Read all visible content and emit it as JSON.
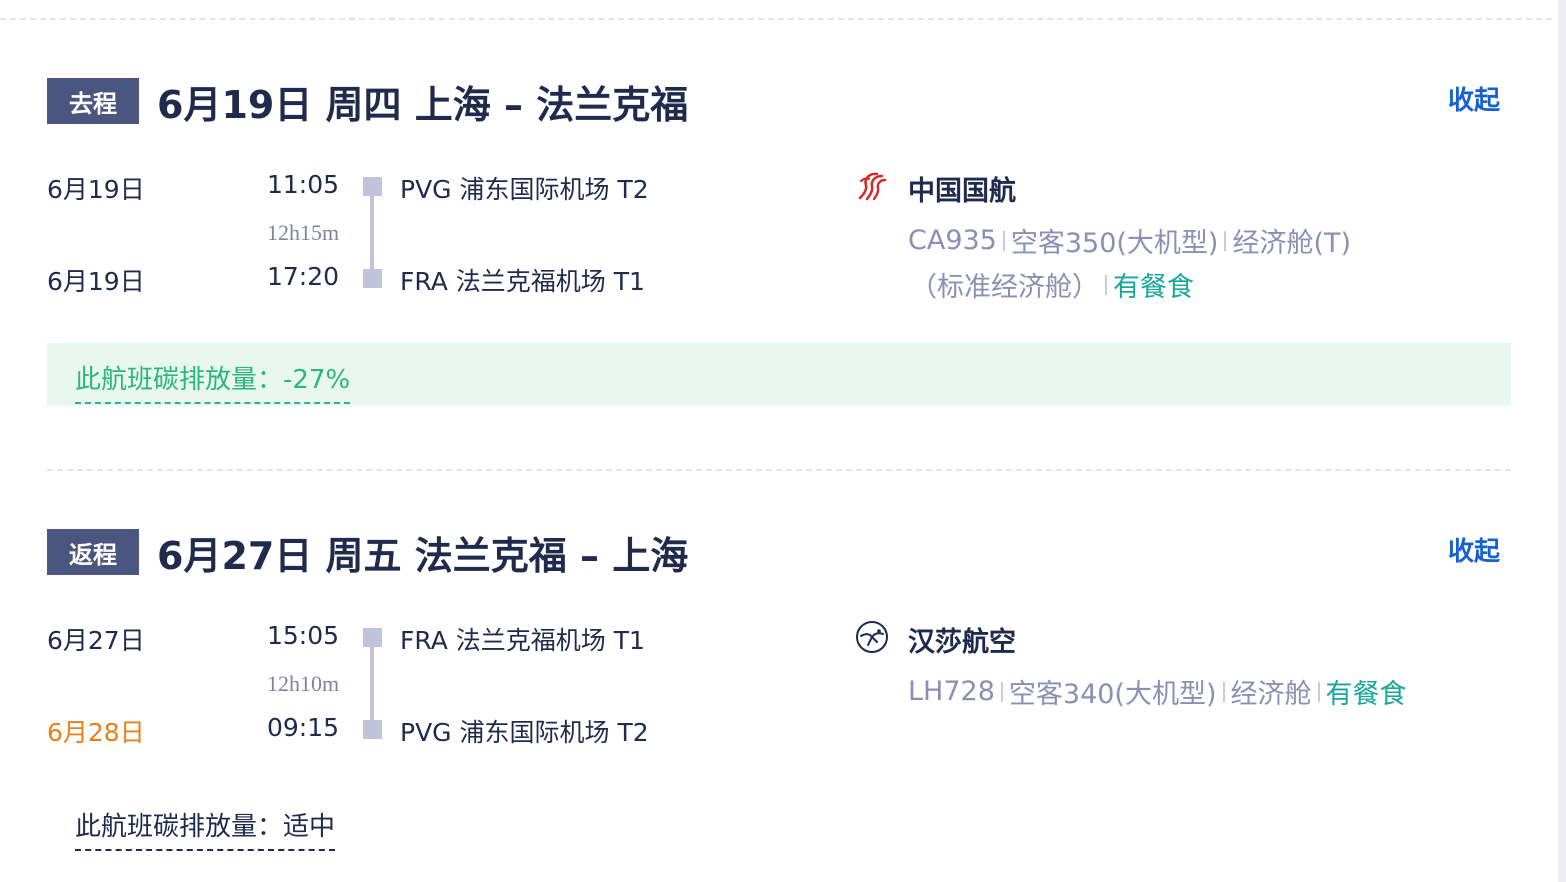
{
  "outbound": {
    "tag": "去程",
    "title": "6月19日 周四 上海 – 法兰克福",
    "collapse_label": "收起",
    "departure": {
      "date": "6月19日",
      "time": "11:05",
      "airport": "PVG 浦东国际机场 T2"
    },
    "duration": "12h15m",
    "arrival": {
      "date": "6月19日",
      "time": "17:20",
      "airport": "FRA 法兰克福机场 T1"
    },
    "airline": {
      "name": "中国国航",
      "logo_icon": "air-china-phoenix-icon",
      "flight_no": "CA935",
      "aircraft": "空客350(大机型)",
      "cabin": "经济舱(T)",
      "cabin_detail": "（标准经济舱）",
      "meal": "有餐食"
    },
    "carbon": "此航班碳排放量：-27%"
  },
  "inbound": {
    "tag": "返程",
    "title": "6月27日 周五 法兰克福 – 上海",
    "collapse_label": "收起",
    "departure": {
      "date": "6月27日",
      "time": "15:05",
      "airport": "FRA 法兰克福机场 T1"
    },
    "duration": "12h10m",
    "arrival": {
      "date": "6月28日",
      "time": "09:15",
      "airport": "PVG 浦东国际机场 T2"
    },
    "airline": {
      "name": "汉莎航空",
      "logo_icon": "lufthansa-crane-icon",
      "flight_no": "LH728",
      "aircraft": "空客340(大机型)",
      "cabin": "经济舱",
      "meal": "有餐食"
    },
    "carbon": "此航班碳排放量：适中"
  },
  "colors": {
    "tag_bg": "#4a5580",
    "link": "#1560d4",
    "next_day": "#e8801c",
    "meal": "#18a79a",
    "carbon_green": "#2bb584",
    "carbon_bg": "#e8f8f1",
    "detail_gray": "#8a90b4"
  }
}
